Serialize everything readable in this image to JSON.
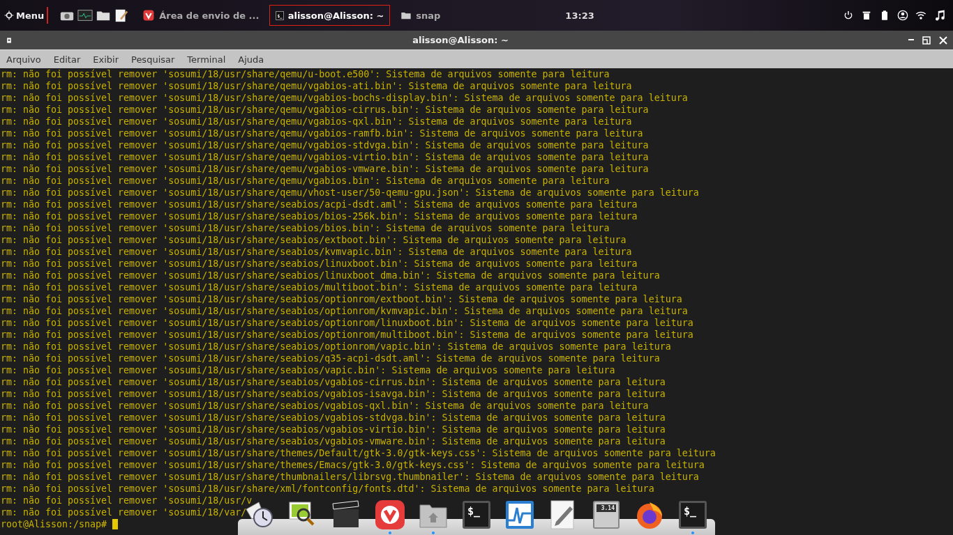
{
  "top_panel": {
    "menu_label": "Menu",
    "launchers": [
      {
        "kind": "camera"
      },
      {
        "kind": "monitor"
      },
      {
        "kind": "folder"
      },
      {
        "kind": "notepad"
      }
    ],
    "tasks": [
      {
        "kind": "browser",
        "label": "Área de envio de ...",
        "selected": false
      },
      {
        "kind": "terminal",
        "label": "alisson@Alisson: ~",
        "glyph": "$_",
        "selected": true
      },
      {
        "kind": "folder",
        "label": "snap",
        "selected": false
      }
    ],
    "clock": "13:23",
    "tray": [
      {
        "kind": "power"
      },
      {
        "kind": "trash"
      },
      {
        "kind": "battery"
      },
      {
        "kind": "user"
      },
      {
        "kind": "wifi"
      },
      {
        "kind": "music"
      }
    ]
  },
  "window": {
    "title": "alisson@Alisson: ~",
    "menu": [
      "Arquivo",
      "Editar",
      "Exibir",
      "Pesquisar",
      "Terminal",
      "Ajuda"
    ],
    "lines": [
      "rm: não foi possível remover 'sosumi/18/usr/share/qemu/u-boot.e500': Sistema de arquivos somente para leitura",
      "rm: não foi possível remover 'sosumi/18/usr/share/qemu/vgabios-ati.bin': Sistema de arquivos somente para leitura",
      "rm: não foi possível remover 'sosumi/18/usr/share/qemu/vgabios-bochs-display.bin': Sistema de arquivos somente para leitura",
      "rm: não foi possível remover 'sosumi/18/usr/share/qemu/vgabios-cirrus.bin': Sistema de arquivos somente para leitura",
      "rm: não foi possível remover 'sosumi/18/usr/share/qemu/vgabios-qxl.bin': Sistema de arquivos somente para leitura",
      "rm: não foi possível remover 'sosumi/18/usr/share/qemu/vgabios-ramfb.bin': Sistema de arquivos somente para leitura",
      "rm: não foi possível remover 'sosumi/18/usr/share/qemu/vgabios-stdvga.bin': Sistema de arquivos somente para leitura",
      "rm: não foi possível remover 'sosumi/18/usr/share/qemu/vgabios-virtio.bin': Sistema de arquivos somente para leitura",
      "rm: não foi possível remover 'sosumi/18/usr/share/qemu/vgabios-vmware.bin': Sistema de arquivos somente para leitura",
      "rm: não foi possível remover 'sosumi/18/usr/share/qemu/vgabios.bin': Sistema de arquivos somente para leitura",
      "rm: não foi possível remover 'sosumi/18/usr/share/qemu/vhost-user/50-qemu-gpu.json': Sistema de arquivos somente para leitura",
      "rm: não foi possível remover 'sosumi/18/usr/share/seabios/acpi-dsdt.aml': Sistema de arquivos somente para leitura",
      "rm: não foi possível remover 'sosumi/18/usr/share/seabios/bios-256k.bin': Sistema de arquivos somente para leitura",
      "rm: não foi possível remover 'sosumi/18/usr/share/seabios/bios.bin': Sistema de arquivos somente para leitura",
      "rm: não foi possível remover 'sosumi/18/usr/share/seabios/extboot.bin': Sistema de arquivos somente para leitura",
      "rm: não foi possível remover 'sosumi/18/usr/share/seabios/kvmvapic.bin': Sistema de arquivos somente para leitura",
      "rm: não foi possível remover 'sosumi/18/usr/share/seabios/linuxboot.bin': Sistema de arquivos somente para leitura",
      "rm: não foi possível remover 'sosumi/18/usr/share/seabios/linuxboot_dma.bin': Sistema de arquivos somente para leitura",
      "rm: não foi possível remover 'sosumi/18/usr/share/seabios/multiboot.bin': Sistema de arquivos somente para leitura",
      "rm: não foi possível remover 'sosumi/18/usr/share/seabios/optionrom/extboot.bin': Sistema de arquivos somente para leitura",
      "rm: não foi possível remover 'sosumi/18/usr/share/seabios/optionrom/kvmvapic.bin': Sistema de arquivos somente para leitura",
      "rm: não foi possível remover 'sosumi/18/usr/share/seabios/optionrom/linuxboot.bin': Sistema de arquivos somente para leitura",
      "rm: não foi possível remover 'sosumi/18/usr/share/seabios/optionrom/multiboot.bin': Sistema de arquivos somente para leitura",
      "rm: não foi possível remover 'sosumi/18/usr/share/seabios/optionrom/vapic.bin': Sistema de arquivos somente para leitura",
      "rm: não foi possível remover 'sosumi/18/usr/share/seabios/q35-acpi-dsdt.aml': Sistema de arquivos somente para leitura",
      "rm: não foi possível remover 'sosumi/18/usr/share/seabios/vapic.bin': Sistema de arquivos somente para leitura",
      "rm: não foi possível remover 'sosumi/18/usr/share/seabios/vgabios-cirrus.bin': Sistema de arquivos somente para leitura",
      "rm: não foi possível remover 'sosumi/18/usr/share/seabios/vgabios-isavga.bin': Sistema de arquivos somente para leitura",
      "rm: não foi possível remover 'sosumi/18/usr/share/seabios/vgabios-qxl.bin': Sistema de arquivos somente para leitura",
      "rm: não foi possível remover 'sosumi/18/usr/share/seabios/vgabios-stdvga.bin': Sistema de arquivos somente para leitura",
      "rm: não foi possível remover 'sosumi/18/usr/share/seabios/vgabios-virtio.bin': Sistema de arquivos somente para leitura",
      "rm: não foi possível remover 'sosumi/18/usr/share/seabios/vgabios-vmware.bin': Sistema de arquivos somente para leitura",
      "rm: não foi possível remover 'sosumi/18/usr/share/themes/Default/gtk-3.0/gtk-keys.css': Sistema de arquivos somente para leitura",
      "rm: não foi possível remover 'sosumi/18/usr/share/themes/Emacs/gtk-3.0/gtk-keys.css': Sistema de arquivos somente para leitura",
      "rm: não foi possível remover 'sosumi/18/usr/share/thumbnailers/librsvg.thumbnailer': Sistema de arquivos somente para leitura",
      "rm: não foi possível remover 'sosumi/18/usr/share/xml/fontconfig/fonts.dtd': Sistema de arquivos somente para leitura",
      "rm: não foi possível remover 'sosumi/18/usr/v",
      "rm: não foi possível remover 'sosumi/18/var/"
    ],
    "prompt": "root@Alisson:/snap#"
  },
  "dock": {
    "items": [
      {
        "kind": "mail-clock",
        "running": false
      },
      {
        "kind": "image-viewer",
        "running": false
      },
      {
        "kind": "video",
        "running": false
      },
      {
        "kind": "browser",
        "running": true
      },
      {
        "kind": "folder",
        "running": true
      },
      {
        "kind": "terminal",
        "glyph": "$_",
        "running": false
      },
      {
        "kind": "monitor",
        "running": false
      },
      {
        "kind": "editor",
        "running": false
      },
      {
        "kind": "calculator",
        "glyph": "3.14",
        "running": false
      },
      {
        "kind": "firefox",
        "running": false
      },
      {
        "kind": "terminal",
        "glyph": "$_",
        "running": true
      }
    ]
  }
}
